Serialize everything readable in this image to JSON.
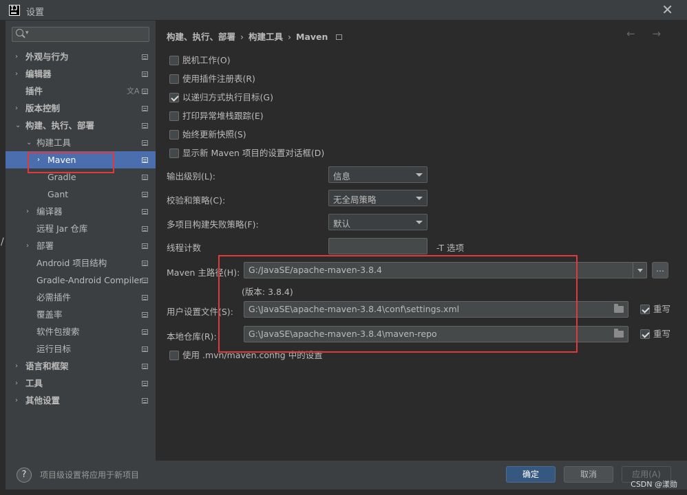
{
  "window": {
    "title": "设置",
    "close_glyph": "✕"
  },
  "sidebar": {
    "search_placeholder": "",
    "items": [
      {
        "label": "外观与行为",
        "arrow": "›",
        "bold": true
      },
      {
        "label": "编辑器",
        "arrow": "›",
        "bold": true
      },
      {
        "label": "插件",
        "arrow": "",
        "bold": true
      },
      {
        "label": "版本控制",
        "arrow": "›",
        "bold": true
      },
      {
        "label": "构建、执行、部署",
        "arrow": "⌄",
        "bold": true
      },
      {
        "label": "构建工具",
        "arrow": "⌄",
        "bold": false
      },
      {
        "label": "Maven",
        "arrow": "›",
        "bold": false,
        "selected": true
      },
      {
        "label": "Gradle",
        "arrow": "",
        "bold": false
      },
      {
        "label": "Gant",
        "arrow": "",
        "bold": false
      },
      {
        "label": "编译器",
        "arrow": "›",
        "bold": false
      },
      {
        "label": "远程 Jar 仓库",
        "arrow": "",
        "bold": false
      },
      {
        "label": "部署",
        "arrow": "›",
        "bold": false
      },
      {
        "label": "Android 项目结构",
        "arrow": "",
        "bold": false
      },
      {
        "label": "Gradle-Android Compiler",
        "arrow": "",
        "bold": false
      },
      {
        "label": "必需插件",
        "arrow": "",
        "bold": false
      },
      {
        "label": "覆盖率",
        "arrow": "",
        "bold": false
      },
      {
        "label": "软件包搜索",
        "arrow": "",
        "bold": false
      },
      {
        "label": "运行目标",
        "arrow": "",
        "bold": false
      },
      {
        "label": "语言和框架",
        "arrow": "›",
        "bold": true
      },
      {
        "label": "工具",
        "arrow": "›",
        "bold": true
      },
      {
        "label": "其他设置",
        "arrow": "›",
        "bold": true
      }
    ]
  },
  "breadcrumb": {
    "parts": [
      "构建、执行、部署",
      "构建工具",
      "Maven"
    ],
    "separator": "›",
    "nav_arrows": "← →"
  },
  "options": [
    {
      "label": "脱机工作(O)",
      "checked": false
    },
    {
      "label": "使用插件注册表(R)",
      "checked": false
    },
    {
      "label": "以递归方式执行目标(G)",
      "checked": true
    },
    {
      "label": "打印异常堆栈跟踪(E)",
      "checked": false
    },
    {
      "label": "始终更新快照(S)",
      "checked": false
    },
    {
      "label": "显示新 Maven 项目的设置对话框(D)",
      "checked": false
    }
  ],
  "fields": {
    "output_level": {
      "label": "输出级别(L):",
      "value": "信息"
    },
    "checksum_policy": {
      "label": "校验和策略(C):",
      "value": "无全局策略"
    },
    "failure_policy": {
      "label": "多项目构建失败策略(F):",
      "value": "默认"
    },
    "thread_count": {
      "label": "线程计数",
      "value": "",
      "suffix": "-T 选项"
    },
    "maven_home": {
      "label": "Maven 主路径(H):",
      "value": "G:/JavaSE/apache-maven-3.8.4",
      "version": "(版本: 3.8.4)",
      "browse": "..."
    },
    "user_settings": {
      "label": "用户设置文件(S):",
      "value": "G:\\JavaSE\\apache-maven-3.8.4\\conf\\settings.xml",
      "override_label": "重写",
      "override_checked": true
    },
    "local_repo": {
      "label": "本地仓库(R):",
      "value": "G:\\JavaSE\\apache-maven-3.8.4\\maven-repo",
      "override_label": "重写",
      "override_checked": true
    },
    "use_mvn_config": {
      "label": "使用 .mvn/maven.config 中的设置",
      "checked": false
    }
  },
  "footer": {
    "help": "?",
    "note": "项目级设置将应用于新项目",
    "ok": "确定",
    "cancel": "取消",
    "apply": "应用(A)"
  },
  "watermark": "CSDN @漾勋",
  "colors": {
    "accent": "#4b6eaf",
    "highlight_box": "#e03a3a",
    "primary_button": "#365880"
  }
}
